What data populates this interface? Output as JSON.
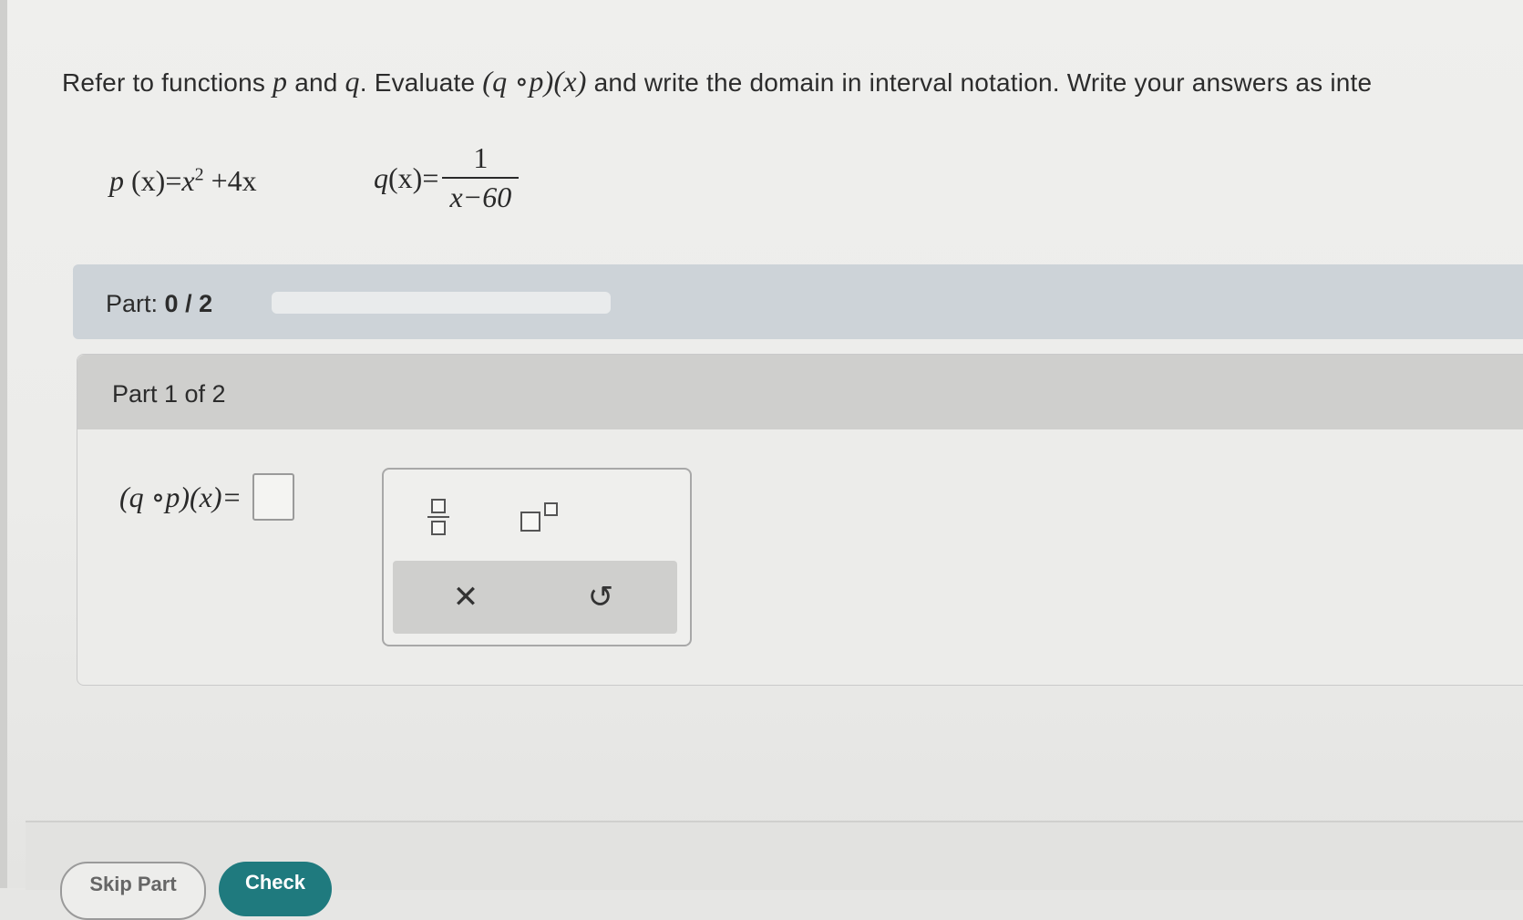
{
  "question": {
    "prefix": "Refer to functions",
    "var_p": "p",
    "and_word": "and",
    "var_q": "q",
    "after_q": ". Evaluate",
    "composition": "(q ∘p)(x)",
    "suffix": "and write the domain in interval notation. Write your answers as inte"
  },
  "functions": {
    "p_def": {
      "name": "p",
      "args": "(x)=",
      "body": "x",
      "exponent": "2",
      "tail": " +4x"
    },
    "q_def": {
      "name": "q",
      "args": "(x)=",
      "numerator": "1",
      "denominator": "x−60"
    }
  },
  "progress": {
    "label": "Part:",
    "value_text": "0 / 2",
    "fraction": 0
  },
  "part": {
    "header": "Part 1 of 2",
    "answer_label": "(q ∘p)(x)="
  },
  "toolbox": {
    "fraction_icon": "fraction-template-icon",
    "exponent_icon": "exponent-template-icon",
    "clear_symbol": "✕",
    "undo_symbol": "↺"
  },
  "footer": {
    "skip_label": "Skip Part",
    "check_label": "Check"
  }
}
